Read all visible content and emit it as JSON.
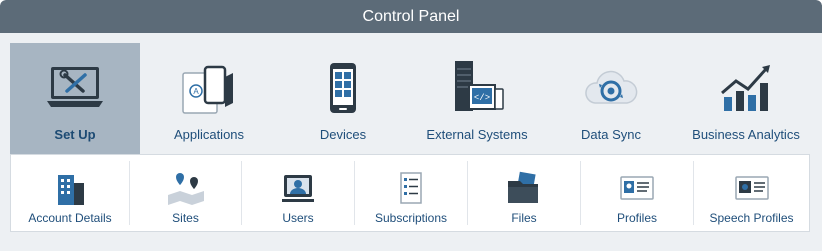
{
  "window": {
    "title": "Control Panel"
  },
  "categories": [
    {
      "label": "Set Up",
      "icon": "laptop-tools-icon",
      "active": true
    },
    {
      "label": "Applications",
      "icon": "tablet-phone-icon"
    },
    {
      "label": "Devices",
      "icon": "smartphone-icon"
    },
    {
      "label": "External Systems",
      "icon": "server-code-icon"
    },
    {
      "label": "Data Sync",
      "icon": "cloud-sync-icon"
    },
    {
      "label": "Business Analytics",
      "icon": "bar-chart-trend-icon"
    }
  ],
  "subitems": [
    {
      "label": "Account Details",
      "icon": "building-icon"
    },
    {
      "label": "Sites",
      "icon": "map-pins-icon"
    },
    {
      "label": "Users",
      "icon": "user-monitor-icon"
    },
    {
      "label": "Subscriptions",
      "icon": "checklist-icon"
    },
    {
      "label": "Files",
      "icon": "folder-icon"
    },
    {
      "label": "Profiles",
      "icon": "profile-card-icon"
    },
    {
      "label": "Speech Profiles",
      "icon": "speech-profile-card-icon"
    }
  ],
  "colors": {
    "titlebar": "#5c6b78",
    "active_tab": "#a7b5c2",
    "icon_blue": "#2f6fa6",
    "icon_dark": "#2d3a45",
    "label_text": "#1f4e7a"
  }
}
